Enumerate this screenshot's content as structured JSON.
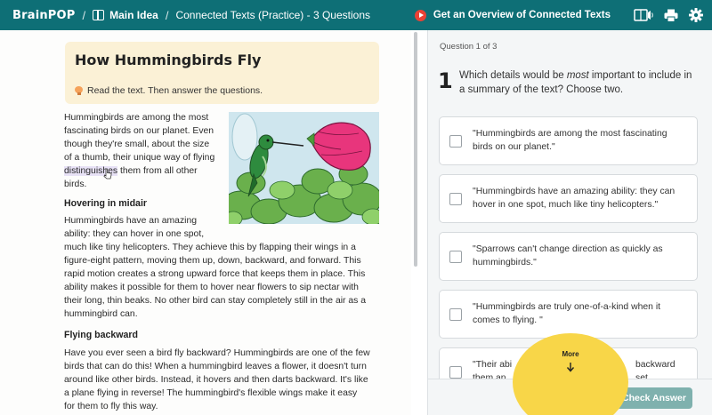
{
  "header": {
    "brand": "BrainPOP",
    "sep1": "/",
    "topic": "Main Idea",
    "sep2": "/",
    "activity": "Connected Texts (Practice) - 3 Questions",
    "overview_label": "Get an Overview of Connected Texts",
    "icons": [
      "book-icon",
      "play-icon",
      "read-aloud-icon",
      "print-icon",
      "settings-gear-icon"
    ]
  },
  "article": {
    "title": "How Hummingbirds Fly",
    "instructions": "Read the text. Then answer the questions.",
    "intro_lines": [
      "Hummingbirds are among the most",
      "fascinating birds on our planet. Even",
      "though they're small, about the size",
      "of a thumb, their unique way of flying",
      "distinguishes",
      " them from all other",
      "birds."
    ],
    "section1_heading": "Hovering in midair",
    "section1_lines": [
      "Hummingbirds have an amazing",
      "ability: they can hover in one spot,",
      "much like tiny helicopters. They achieve this by flapping their wings in a",
      "figure-eight pattern, moving them up, down, backward, and forward. This",
      "rapid motion creates a strong upward force that keeps them in place. This",
      "ability makes it possible for them to hover near flowers to sip nectar with",
      "their long, thin beaks. No other bird can stay completely still in the air as a",
      "hummingbird can."
    ],
    "section2_heading": "Flying backward",
    "section2_lines": [
      "Have you ever seen a bird fly backward? Hummingbirds are one of the few",
      "birds that can do this! When a hummingbird leaves a flower, it doesn't turn",
      "around like other birds. Instead, it hovers and then darts backward. It's like",
      "a plane flying in reverse! The hummingbird's flexible wings make it easy",
      "for them to fly this way."
    ]
  },
  "question": {
    "counter": "Question 1 of 3",
    "number": "1",
    "text_before": "Which details would be ",
    "text_emphasis": "most",
    "text_after": " important to include in a summary of the text? Choose two.",
    "options": [
      {
        "label": "\"Hummingbirds are among the most fascinating birds on our planet.\"",
        "checked": false
      },
      {
        "label": "\"Hummingbirds have an amazing ability: they can hover in one spot, much like tiny helicopters.\"",
        "checked": false
      },
      {
        "label": "\"Sparrows can't change direction as quickly as hummingbirds.\"",
        "checked": false
      },
      {
        "label": "\"Hummingbirds are truly one-of-a-kind when it comes to flying. \"",
        "checked": false
      },
      {
        "label_left": "\"Their abi",
        "label_right": "backward set",
        "label_line2": "them an",
        "checked": false
      }
    ],
    "more_label": "More",
    "check_answer_label": "Check Answer"
  },
  "colors": {
    "topbar": "#0e6f76",
    "header_card": "#fbf1d6",
    "more_button": "#f8d648",
    "check_button": "#7fb1ae",
    "highlight": "#e8e2f6"
  }
}
